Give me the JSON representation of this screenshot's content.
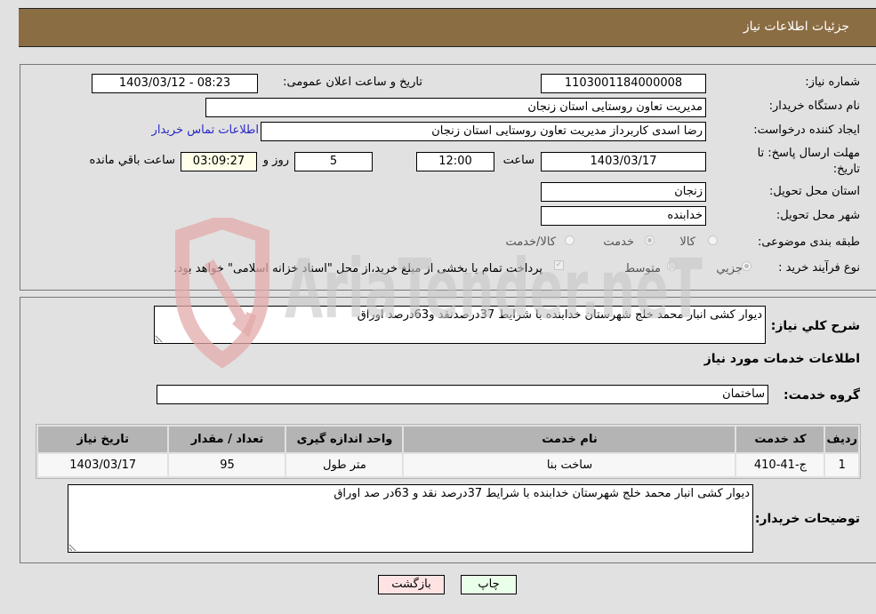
{
  "header": {
    "title": "جزئیات اطلاعات نیاز"
  },
  "need_info": {
    "need_number": {
      "label": "شماره نیاز:",
      "value": "1103001184000008"
    },
    "announce_datetime": {
      "label": "تاریخ و ساعت اعلان عمومی:",
      "value": "1403/03/12 - 08:23"
    },
    "buyer_org": {
      "label": "نام دستگاه خریدار:",
      "value": "مدیریت تعاون روستایی استان زنجان"
    },
    "requester": {
      "label": "ایجاد کننده درخواست:",
      "value": "رضا اسدی کاربرداز مدیریت تعاون روستایی استان زنجان"
    },
    "buyer_contact_link": "اطلاعات تماس خریدار",
    "deadline": {
      "label_line1": "مهلت ارسال پاسخ: تا",
      "label_line2": "تاریخ:",
      "date": "1403/03/17",
      "time_label": "ساعت",
      "time": "12:00",
      "days": "5",
      "days_label": "روز و",
      "remaining": "03:09:27",
      "remaining_label": "ساعت باقي مانده"
    },
    "delivery_province": {
      "label": "استان محل تحویل:",
      "value": "زنجان"
    },
    "delivery_city": {
      "label": "شهر محل تحویل:",
      "value": "خدابنده"
    },
    "category": {
      "label": "طبقه بندی موضوعی:",
      "options": [
        "کالا",
        "خدمت",
        "کالا/خدمت"
      ],
      "selected": "خدمت"
    },
    "purchase_process": {
      "label": "نوع فرآیند خرید :",
      "options": [
        "جزيي",
        "متوسط"
      ],
      "selected": "جزيي",
      "payment_note": "پرداخت تمام یا بخشی از مبلغ خرید،از محل \"اسناد خزانه اسلامی\" خواهد بود.",
      "payment_checked": true
    }
  },
  "details": {
    "general_desc": {
      "label": "شرح کلي نياز:",
      "value": "دیوار کشی انبار محمد خلج شهرستان خدابنده با شرایط 37درصدنقد و63درصد اوراق"
    },
    "services_title": "اطلاعات خدمات مورد نياز",
    "service_group": {
      "label": "گروه خدمت:",
      "value": "ساختمان"
    },
    "table": {
      "headers": [
        "ردیف",
        "کد خدمت",
        "نام خدمت",
        "واحد اندازه گیری",
        "تعداد / مقدار",
        "تاریخ نیاز"
      ],
      "rows": [
        [
          "1",
          "ج-41-410",
          "ساخت بنا",
          "متر طول",
          "95",
          "1403/03/17"
        ]
      ]
    },
    "buyer_notes": {
      "label": "توضیحات خریدار:",
      "value": "دیوار کشی انبار محمد خلج شهرستان خدابنده با شرایط 37درصد نقد و 63در صد اوراق"
    }
  },
  "actions": {
    "print": "چاپ",
    "back": "بازگشت"
  },
  "watermark": {
    "text": "AriaTender.neT"
  },
  "colors": {
    "header_bg": "#8b6d44",
    "print_bg": "#eaffea",
    "back_bg": "#ffe3e3",
    "link": "#2828c8"
  }
}
